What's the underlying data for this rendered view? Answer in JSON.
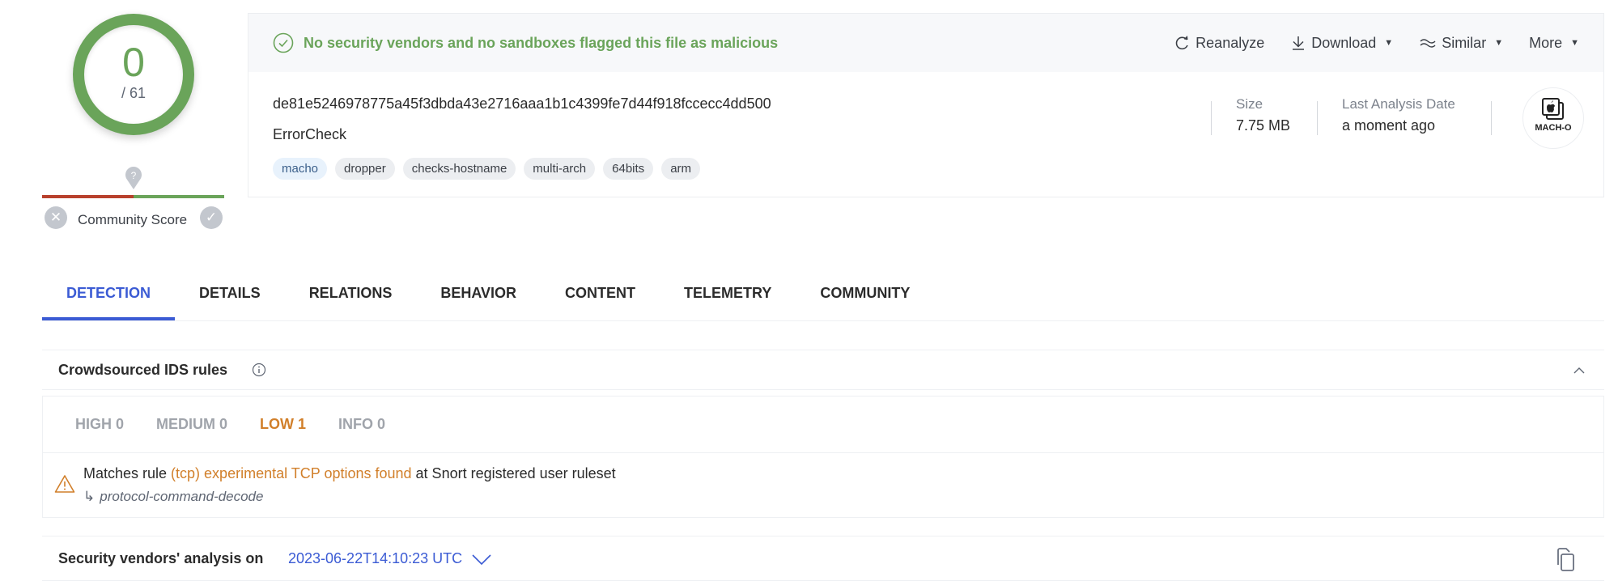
{
  "score": {
    "detections": "0",
    "total": "/ 61"
  },
  "community": {
    "label": "Community Score",
    "marker": "?"
  },
  "banner": {
    "message": "No security vendors and no sandboxes flagged this file as malicious"
  },
  "actions": [
    {
      "label": "Reanalyze",
      "icon": "reanalyze-icon"
    },
    {
      "label": "Download",
      "icon": "download-icon"
    },
    {
      "label": "Similar",
      "icon": "similar-icon"
    },
    {
      "label": "More",
      "icon": ""
    }
  ],
  "file": {
    "hash": "de81e5246978775a45f3dbda43e2716aaa1b1c4399fe7d44f918fccecc4dd500",
    "name": "ErrorCheck",
    "tags": [
      "macho",
      "dropper",
      "checks-hostname",
      "multi-arch",
      "64bits",
      "arm"
    ],
    "size_label": "Size",
    "size_value": "7.75 MB",
    "date_label": "Last Analysis Date",
    "date_value": "a moment ago",
    "type_label": "MACH-O"
  },
  "tabs": [
    "DETECTION",
    "DETAILS",
    "RELATIONS",
    "BEHAVIOR",
    "CONTENT",
    "TELEMETRY",
    "COMMUNITY"
  ],
  "ids": {
    "title": "Crowdsourced IDS rules",
    "severities": [
      "HIGH 0",
      "MEDIUM 0",
      "LOW 1",
      "INFO 0"
    ],
    "rule": {
      "prefix": "Matches rule ",
      "link": "(tcp) experimental TCP options found",
      "suffix": " at Snort registered user ruleset",
      "arrow": "↳",
      "category": "protocol-command-decode"
    }
  },
  "vendors": {
    "title": "Security vendors' analysis on",
    "date": "2023-06-22T14:10:23 UTC"
  },
  "colors": {
    "clean": "#6aa45a",
    "accent": "#3b5bd4",
    "warning": "#d17f2a",
    "danger": "#b8402c"
  }
}
